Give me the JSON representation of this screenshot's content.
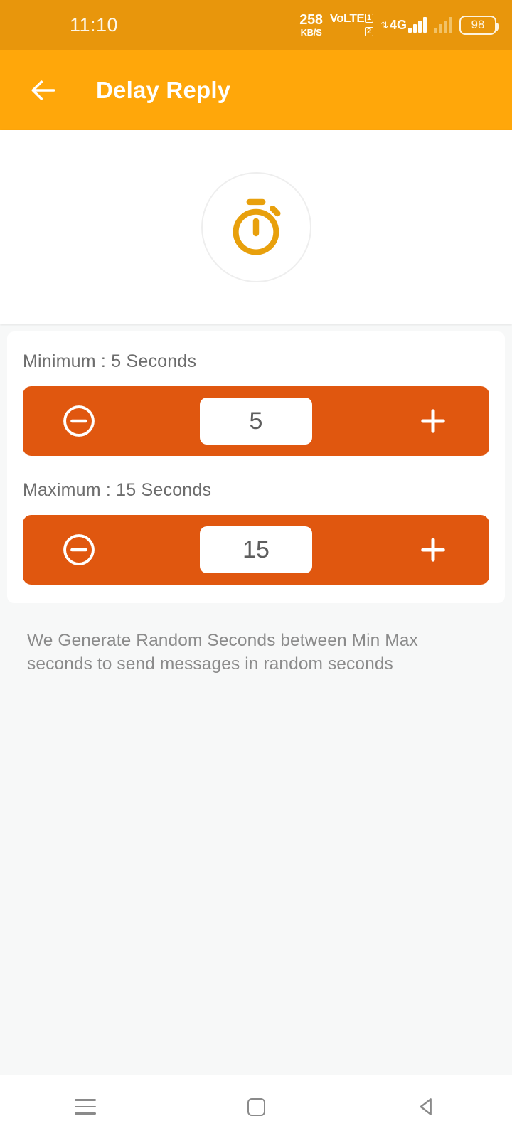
{
  "status_bar": {
    "time": "11:10",
    "net_speed_value": "258",
    "net_speed_unit": "KB/S",
    "volte_label": "VoLTE",
    "volte_sim_1": "1",
    "volte_sim_2": "2",
    "network_type": "4G",
    "battery_level": "98"
  },
  "app_bar": {
    "title": "Delay Reply",
    "back_icon": "arrow-left-icon"
  },
  "hero": {
    "icon": "stopwatch-icon",
    "icon_color": "#E8A00C",
    "circle_border_color": "#EEEEEE"
  },
  "settings": {
    "minimum": {
      "label": "Minimum : 5 Seconds",
      "value": "5",
      "decrement_icon": "minus-circle-icon",
      "increment_icon": "plus-icon"
    },
    "maximum": {
      "label": "Maximum : 15 Seconds",
      "value": "15",
      "decrement_icon": "minus-circle-icon",
      "increment_icon": "plus-icon"
    },
    "stepper_color": "#E0570F"
  },
  "note": "We Generate Random Seconds between Min Max seconds to send messages in random seconds",
  "nav_bar": {
    "recents_icon": "menu-icon",
    "home_icon": "square-icon",
    "back_icon": "triangle-back-icon"
  },
  "theme": {
    "status_bar_color": "#E8960C",
    "app_bar_color": "#FFA70A",
    "page_background": "#F7F8F8"
  }
}
